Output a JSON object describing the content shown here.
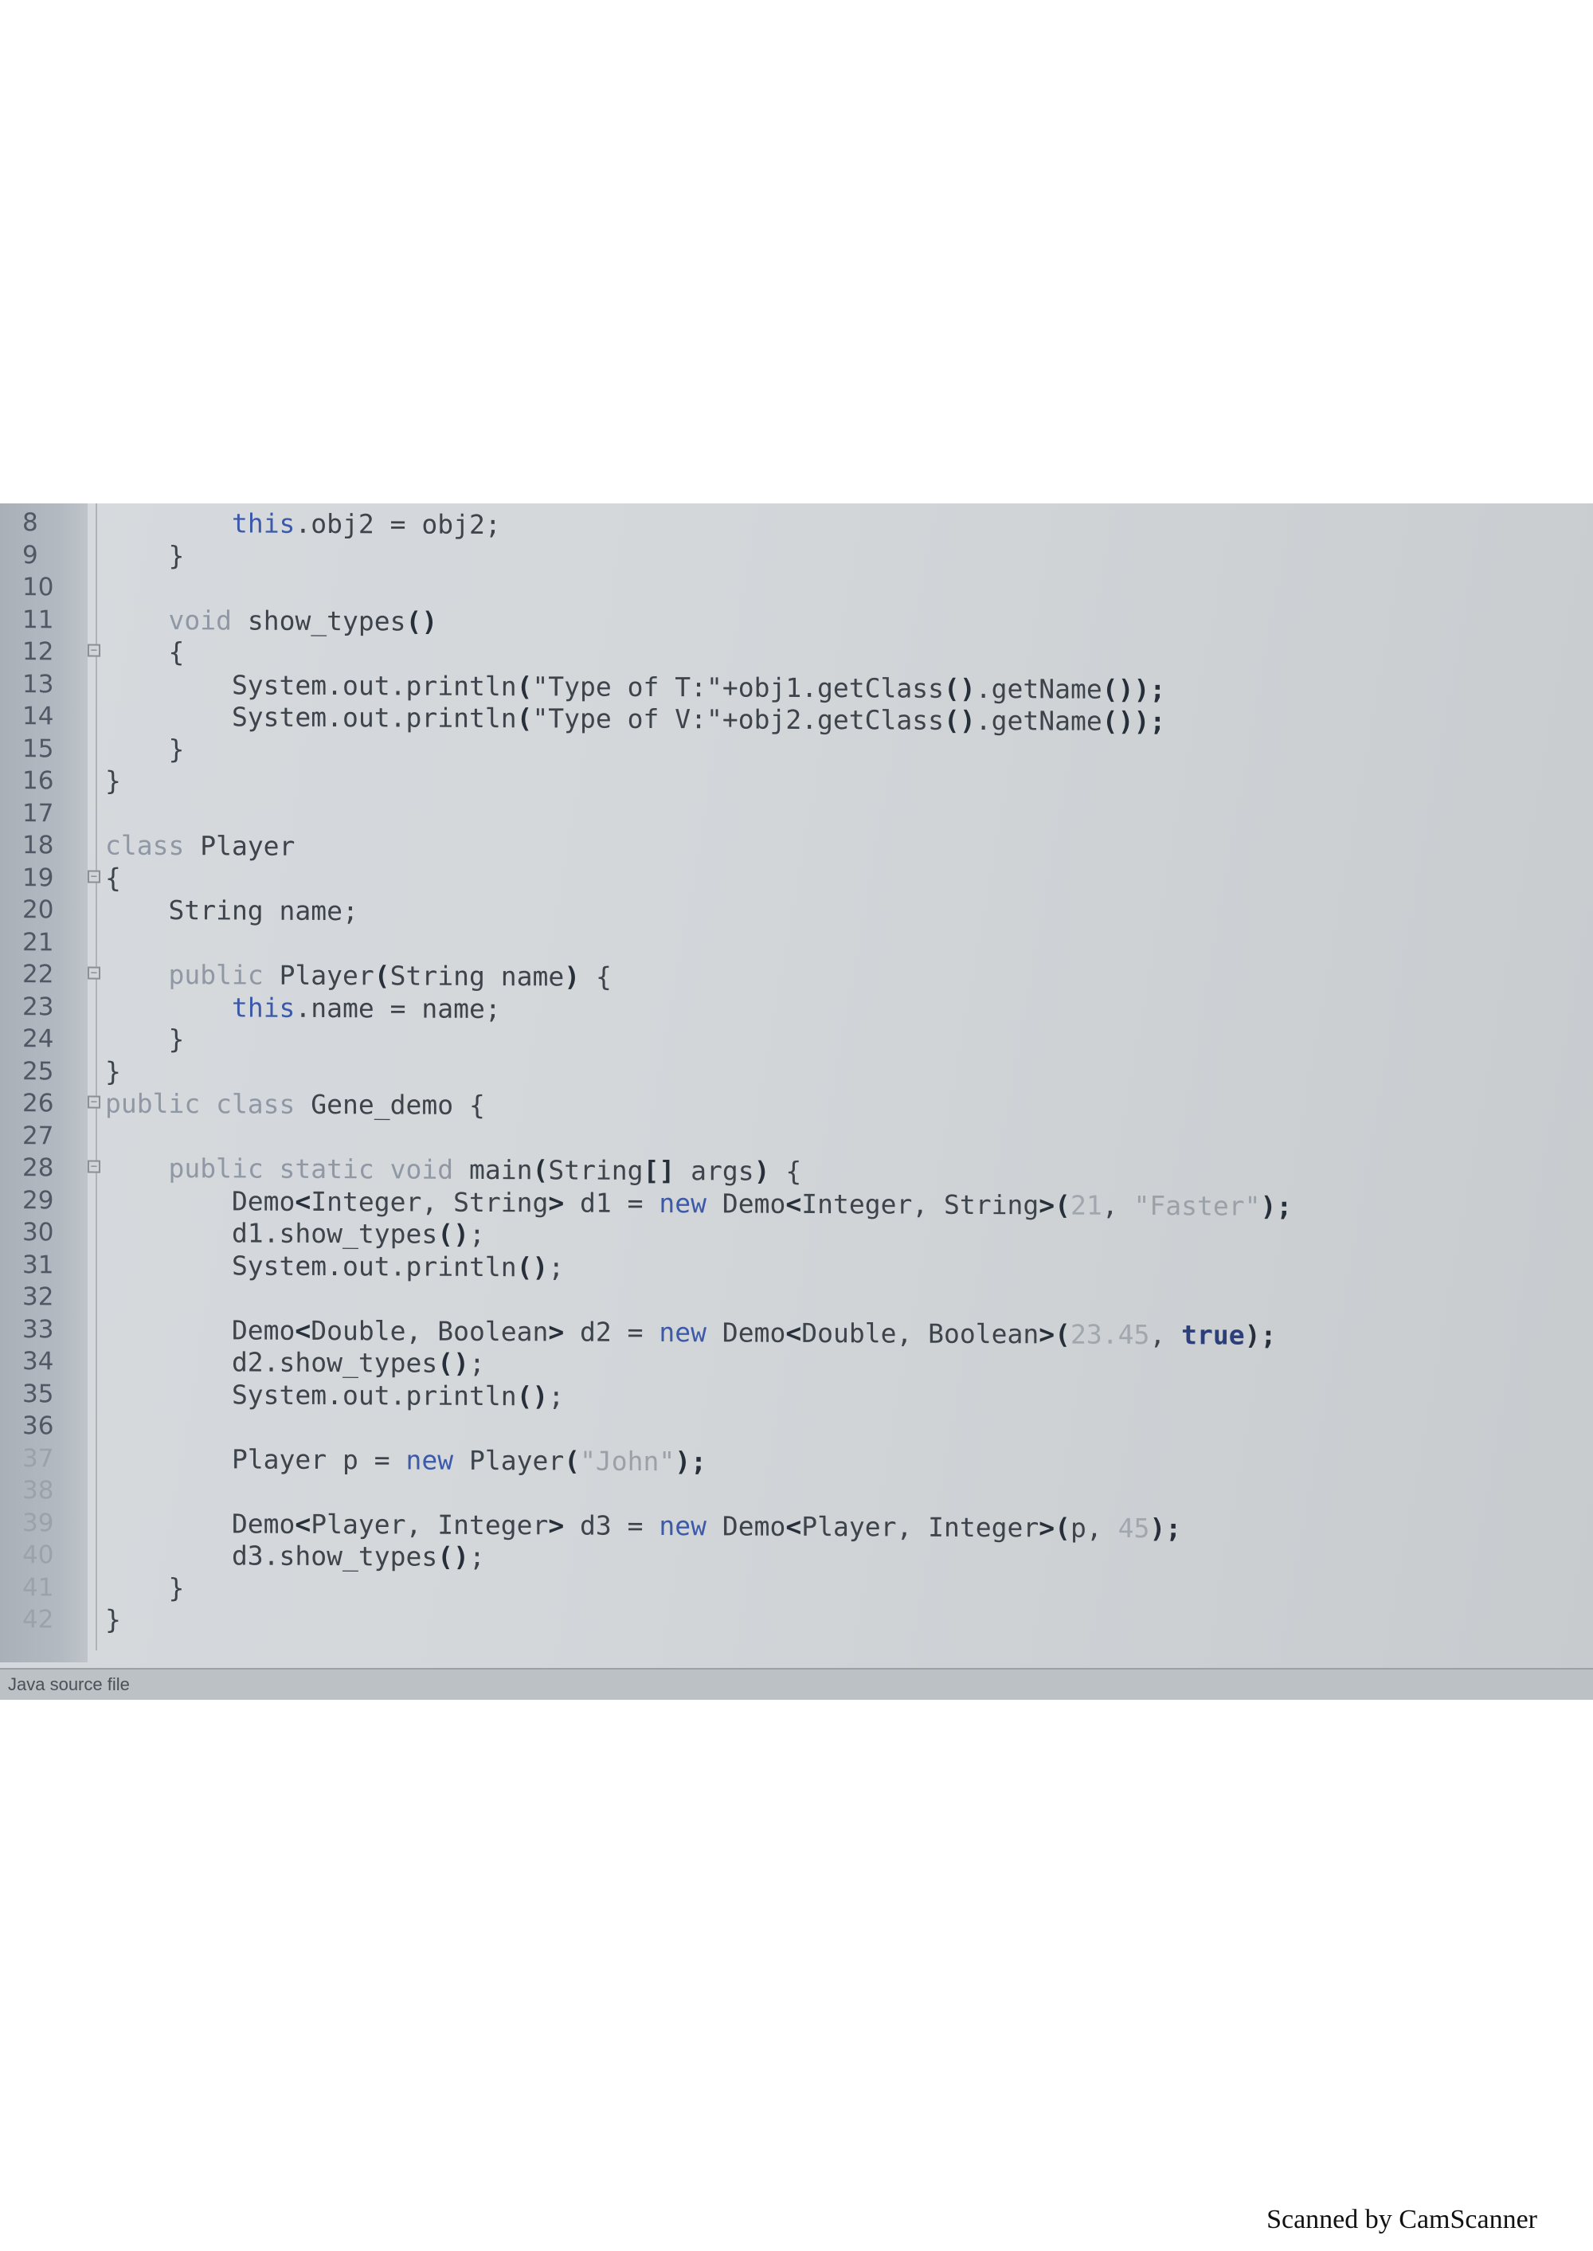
{
  "editor": {
    "lines": [
      {
        "no": "8",
        "fold": "",
        "segments": [
          {
            "t": "        "
          },
          {
            "t": "this",
            "c": "kw"
          },
          {
            "t": ".obj2 = obj2;"
          }
        ]
      },
      {
        "no": "9",
        "fold": "",
        "segments": [
          {
            "t": "    }"
          }
        ]
      },
      {
        "no": "10",
        "fold": "",
        "segments": [
          {
            "t": ""
          }
        ]
      },
      {
        "no": "11",
        "fold": "",
        "segments": [
          {
            "t": "    "
          },
          {
            "t": "void",
            "c": "kwg"
          },
          {
            "t": " show_types"
          },
          {
            "t": "()",
            "c": "b"
          }
        ]
      },
      {
        "no": "12",
        "fold": "−",
        "segments": [
          {
            "t": "    {"
          }
        ]
      },
      {
        "no": "13",
        "fold": "",
        "segments": [
          {
            "t": "        System.out.println"
          },
          {
            "t": "(",
            "c": "b"
          },
          {
            "t": "\"Type of T:\"+obj1.getClass"
          },
          {
            "t": "()",
            "c": "b"
          },
          {
            "t": ".getName"
          },
          {
            "t": "())",
            "c": "b"
          },
          {
            "t": ";",
            "c": "b"
          }
        ]
      },
      {
        "no": "14",
        "fold": "",
        "segments": [
          {
            "t": "        System.out.println"
          },
          {
            "t": "(",
            "c": "b"
          },
          {
            "t": "\"Type of V:\"+obj2.getClass"
          },
          {
            "t": "()",
            "c": "b"
          },
          {
            "t": ".getName"
          },
          {
            "t": "())",
            "c": "b"
          },
          {
            "t": ";",
            "c": "b"
          }
        ]
      },
      {
        "no": "15",
        "fold": "",
        "segments": [
          {
            "t": "    }"
          }
        ]
      },
      {
        "no": "16",
        "fold": "",
        "segments": [
          {
            "t": "}"
          }
        ]
      },
      {
        "no": "17",
        "fold": "",
        "segments": [
          {
            "t": ""
          }
        ]
      },
      {
        "no": "18",
        "fold": "",
        "segments": [
          {
            "t": "class",
            "c": "kwg"
          },
          {
            "t": " Player"
          }
        ]
      },
      {
        "no": "19",
        "fold": "−",
        "segments": [
          {
            "t": "{"
          }
        ]
      },
      {
        "no": "20",
        "fold": "",
        "segments": [
          {
            "t": "    String name;"
          }
        ]
      },
      {
        "no": "21",
        "fold": "",
        "segments": [
          {
            "t": ""
          }
        ]
      },
      {
        "no": "22",
        "fold": "−",
        "segments": [
          {
            "t": "    "
          },
          {
            "t": "public",
            "c": "kwg"
          },
          {
            "t": " Player"
          },
          {
            "t": "(",
            "c": "b"
          },
          {
            "t": "String name"
          },
          {
            "t": ")",
            "c": "b"
          },
          {
            "t": " {"
          }
        ]
      },
      {
        "no": "23",
        "fold": "",
        "segments": [
          {
            "t": "        "
          },
          {
            "t": "this",
            "c": "kw"
          },
          {
            "t": ".name = name;"
          }
        ]
      },
      {
        "no": "24",
        "fold": "",
        "segments": [
          {
            "t": "    }"
          }
        ]
      },
      {
        "no": "25",
        "fold": "",
        "segments": [
          {
            "t": "}"
          }
        ]
      },
      {
        "no": "26",
        "fold": "−",
        "segments": [
          {
            "t": "public class",
            "c": "kwg"
          },
          {
            "t": " Gene_demo {"
          }
        ]
      },
      {
        "no": "27",
        "fold": "",
        "segments": [
          {
            "t": ""
          }
        ]
      },
      {
        "no": "28",
        "fold": "−",
        "segments": [
          {
            "t": "    "
          },
          {
            "t": "public static void",
            "c": "kwg"
          },
          {
            "t": " main"
          },
          {
            "t": "(",
            "c": "b"
          },
          {
            "t": "String"
          },
          {
            "t": "[]",
            "c": "b"
          },
          {
            "t": " args"
          },
          {
            "t": ")",
            "c": "b"
          },
          {
            "t": " {"
          }
        ]
      },
      {
        "no": "29",
        "fold": "",
        "segments": [
          {
            "t": "        Demo"
          },
          {
            "t": "<",
            "c": "b"
          },
          {
            "t": "Integer, String"
          },
          {
            "t": ">",
            "c": "b"
          },
          {
            "t": " d1 = "
          },
          {
            "t": "new",
            "c": "kw"
          },
          {
            "t": " Demo"
          },
          {
            "t": "<",
            "c": "b"
          },
          {
            "t": "Integer, String"
          },
          {
            "t": ">(",
            "c": "b"
          },
          {
            "t": "21",
            "c": "nm"
          },
          {
            "t": ", "
          },
          {
            "t": "\"Faster\"",
            "c": "st"
          },
          {
            "t": ");",
            "c": "b"
          }
        ]
      },
      {
        "no": "30",
        "fold": "",
        "segments": [
          {
            "t": "        d1.show_types"
          },
          {
            "t": "()",
            "c": "b"
          },
          {
            "t": ";"
          }
        ]
      },
      {
        "no": "31",
        "fold": "",
        "segments": [
          {
            "t": "        System.out.println"
          },
          {
            "t": "()",
            "c": "b"
          },
          {
            "t": ";"
          }
        ]
      },
      {
        "no": "32",
        "fold": "",
        "segments": [
          {
            "t": ""
          }
        ]
      },
      {
        "no": "33",
        "fold": "",
        "segments": [
          {
            "t": "        Demo"
          },
          {
            "t": "<",
            "c": "b"
          },
          {
            "t": "Double, Boolean"
          },
          {
            "t": ">",
            "c": "b"
          },
          {
            "t": " d2 = "
          },
          {
            "t": "new",
            "c": "kw"
          },
          {
            "t": " Demo"
          },
          {
            "t": "<",
            "c": "b"
          },
          {
            "t": "Double, Boolean"
          },
          {
            "t": ">(",
            "c": "b"
          },
          {
            "t": "23.45",
            "c": "nm"
          },
          {
            "t": ", "
          },
          {
            "t": "true",
            "c": "bk"
          },
          {
            "t": ");",
            "c": "b"
          }
        ]
      },
      {
        "no": "34",
        "fold": "",
        "segments": [
          {
            "t": "        d2.show_types"
          },
          {
            "t": "()",
            "c": "b"
          },
          {
            "t": ";"
          }
        ]
      },
      {
        "no": "35",
        "fold": "",
        "segments": [
          {
            "t": "        System.out.println"
          },
          {
            "t": "()",
            "c": "b"
          },
          {
            "t": ";"
          }
        ]
      },
      {
        "no": "36",
        "fold": "",
        "segments": [
          {
            "t": ""
          }
        ]
      },
      {
        "no": "37",
        "fold": "",
        "segments": [
          {
            "t": "        Player p = "
          },
          {
            "t": "new",
            "c": "kw"
          },
          {
            "t": " Player"
          },
          {
            "t": "(",
            "c": "b"
          },
          {
            "t": "\"John\"",
            "c": "st"
          },
          {
            "t": ");",
            "c": "b"
          }
        ]
      },
      {
        "no": "38",
        "fold": "",
        "segments": [
          {
            "t": ""
          }
        ]
      },
      {
        "no": "39",
        "fold": "",
        "segments": [
          {
            "t": "        Demo"
          },
          {
            "t": "<",
            "c": "b"
          },
          {
            "t": "Player, Integer"
          },
          {
            "t": ">",
            "c": "b"
          },
          {
            "t": " d3 = "
          },
          {
            "t": "new",
            "c": "kw"
          },
          {
            "t": " Demo"
          },
          {
            "t": "<",
            "c": "b"
          },
          {
            "t": "Player, Integer"
          },
          {
            "t": ">(",
            "c": "b"
          },
          {
            "t": "p, "
          },
          {
            "t": "45",
            "c": "nm"
          },
          {
            "t": ");",
            "c": "b"
          }
        ]
      },
      {
        "no": "40",
        "fold": "",
        "segments": [
          {
            "t": "        d3.show_types"
          },
          {
            "t": "()",
            "c": "b"
          },
          {
            "t": ";"
          }
        ]
      },
      {
        "no": "41",
        "fold": "",
        "segments": [
          {
            "t": "    }"
          }
        ]
      },
      {
        "no": "42",
        "fold": "",
        "segments": [
          {
            "t": "}"
          }
        ]
      }
    ]
  },
  "status_bar": {
    "text": "Java source file"
  },
  "watermark": {
    "text": "Scanned by CamScanner"
  },
  "colors": {
    "keyword_blue": "#3c5aa8",
    "keyword_grey": "#8f98a4",
    "string_literal": "#9aa1a8"
  }
}
